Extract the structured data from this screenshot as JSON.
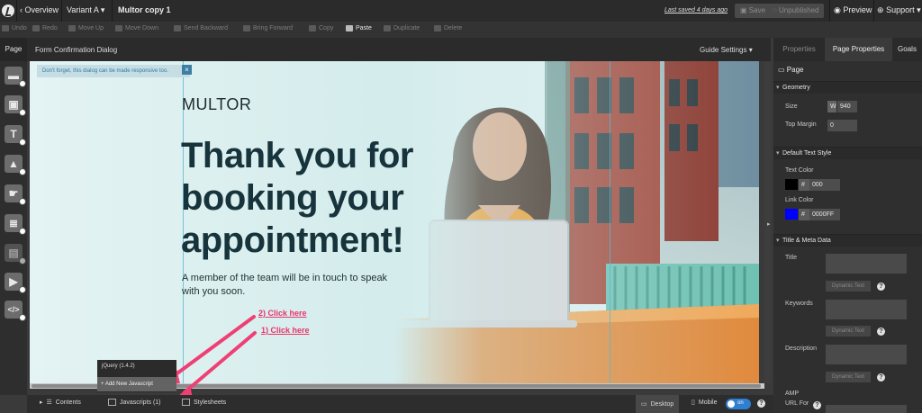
{
  "topbar": {
    "overview": "Overview",
    "variant": "Variant A",
    "page_name": "Multor copy 1",
    "last_saved": "Last saved  4 days ago",
    "save": "Save",
    "unpublished": "Unpublished",
    "preview": "Preview",
    "support": "Support"
  },
  "toolbar": {
    "undo": "Undo",
    "redo": "Redo",
    "move_up": "Move Up",
    "move_down": "Move Down",
    "send_backward": "Send Backward",
    "bring_forward": "Bring Forward",
    "copy": "Copy",
    "paste": "Paste",
    "duplicate": "Duplicate",
    "delete": "Delete"
  },
  "left_panel": {
    "page_tab": "Page"
  },
  "canvas_header": {
    "title": "Form Confirmation Dialog",
    "guide_settings": "Guide Settings"
  },
  "canvas": {
    "notice": "Don't forget, this dialog can be made responsive too.",
    "notice_close": "×",
    "brand": "MULTOR",
    "headline": [
      "Thank you for",
      "booking your",
      "appointment!"
    ],
    "subtext": "A member of the team will be in touch to speak with you soon.",
    "annotation_2": "2) Click here",
    "annotation_1": "1) Click here"
  },
  "js_menu": {
    "jquery": "jQuery (1.4.2)",
    "add_new": "+ Add New Javascript"
  },
  "bottombar": {
    "contents": "Contents",
    "javascripts": "Javascripts (1)",
    "stylesheets": "Stylesheets",
    "desktop": "Desktop",
    "mobile": "Mobile",
    "toggle": "on",
    "help": "?"
  },
  "right_panel": {
    "tabs": [
      "Properties",
      "Page Properties",
      "Goals"
    ],
    "page_label": "Page",
    "geometry": {
      "title": "Geometry",
      "size_label": "Size",
      "size_prefix": "W",
      "size_value": "940",
      "top_margin_label": "Top Margin",
      "top_margin_value": "0"
    },
    "default_text_style": {
      "title": "Default Text Style",
      "text_color_label": "Text Color",
      "text_color_value": "000",
      "link_color_label": "Link Color",
      "link_color_value": "0000FF",
      "hash": "#"
    },
    "title_meta": {
      "title": "Title & Meta Data",
      "title_label": "Title",
      "keywords_label": "Keywords",
      "description_label": "Description",
      "amp_label": "AMP",
      "url_label": "URL For",
      "dynamic_text": "Dynamic Text",
      "help": "?"
    }
  },
  "colors": {
    "accent_pink": "#e9346b",
    "guide_blue": "#59b7d3",
    "link_blue": "#0000ff",
    "text_black": "#000000"
  }
}
